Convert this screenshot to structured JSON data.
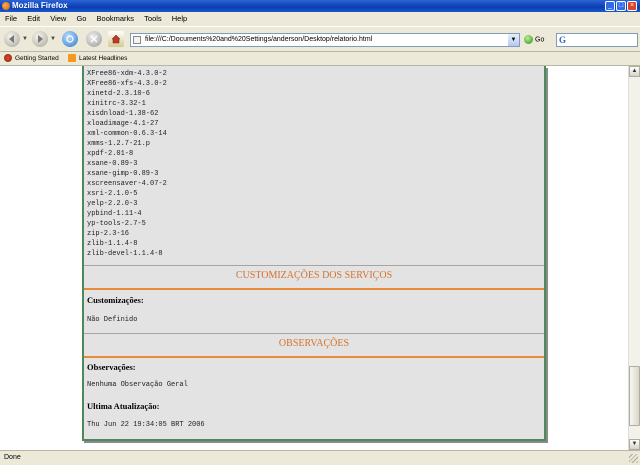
{
  "window": {
    "title": "Mozilla Firefox"
  },
  "menu": [
    "File",
    "Edit",
    "View",
    "Go",
    "Bookmarks",
    "Tools",
    "Help"
  ],
  "toolbar": {
    "url": "file:///C:/Documents%20and%20Settings/anderson/Desktop/relatorio.html",
    "go_label": "Go"
  },
  "bookmarks": [
    "Getting Started",
    "Latest Headlines"
  ],
  "report": {
    "packages": [
      "XFree86-xdm-4.3.0-2",
      "XFree86-xfs-4.3.0-2",
      "xinetd-2.3.10-6",
      "xinitrc-3.32-1",
      "xisdnload-1.38-62",
      "xloadimage-4.1-27",
      "xml-common-0.6.3-14",
      "xmms-1.2.7-21.p",
      "xpdf-2.01-8",
      "xsane-0.89-3",
      "xsane-gimp-0.89-3",
      "xscreensaver-4.07-2",
      "xsri-2.1.0-5",
      "yelp-2.2.0-3",
      "ypbind-1.11-4",
      "yp-tools-2.7-5",
      "zip-2.3-16",
      "zlib-1.1.4-8",
      "zlib-devel-1.1.4-8"
    ],
    "section_services": "CUSTOMIZAÇÕES DOS SERVIÇOS",
    "customizations_label": "Customizações:",
    "customizations_value": "Não Definido",
    "section_notes": "OBSERVAÇÕES",
    "notes_label": "Observações:",
    "notes_value": "Nenhuma Observação Geral",
    "update_label": "Ultima Atualização:",
    "update_value": "Thu Jun 22 19:34:05 BRT 2006"
  },
  "status": {
    "text": "Done"
  }
}
